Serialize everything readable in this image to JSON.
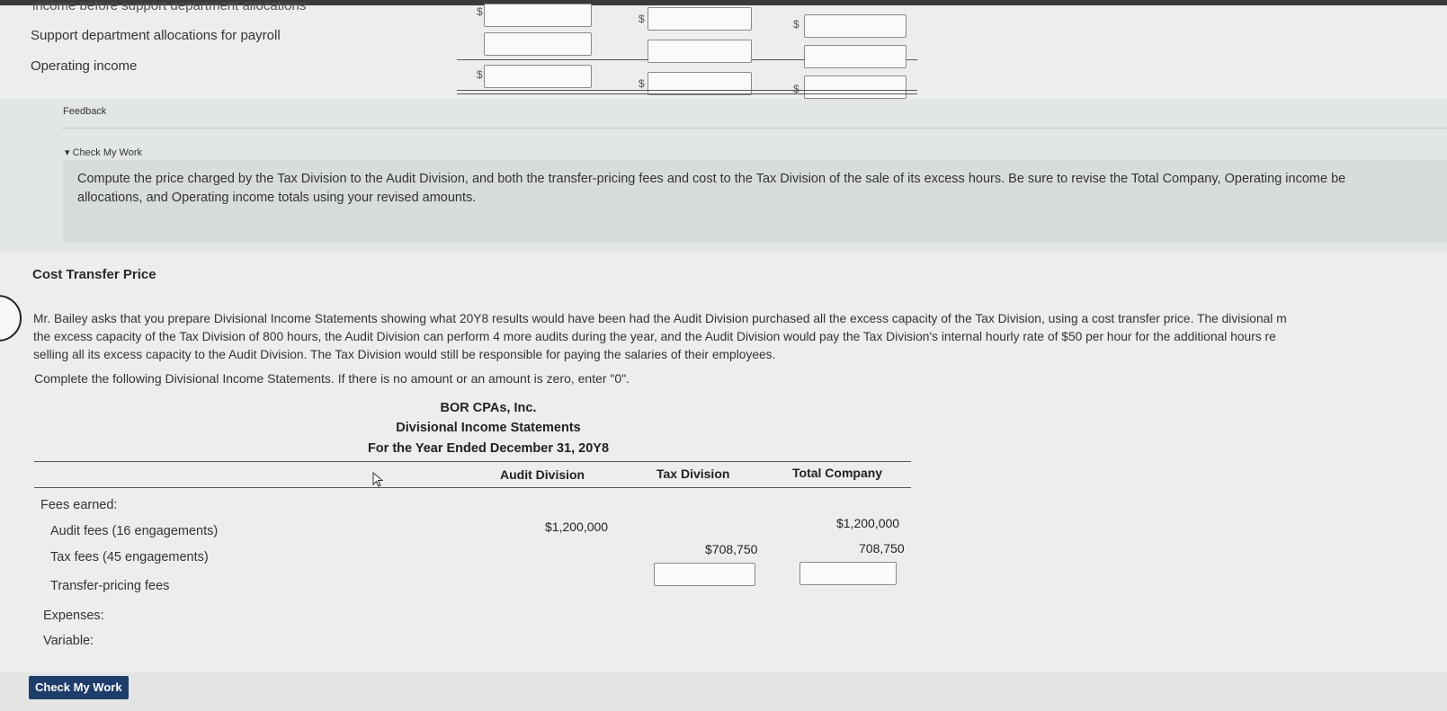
{
  "top_section": {
    "rows": [
      {
        "label": "income before support department allocations",
        "dollars": [
          "$",
          "$",
          "$"
        ]
      },
      {
        "label": "Support department allocations for payroll",
        "dollars": [
          "",
          "",
          ""
        ]
      },
      {
        "label": "Operating income",
        "dollars": [
          "$",
          "$",
          "$"
        ]
      }
    ]
  },
  "feedback": {
    "label": "Feedback",
    "toggle": "▾ Check My Work",
    "text_line1": "Compute the price charged by the Tax Division to the Audit Division, and both the transfer-pricing fees and cost to the Tax Division of the sale of its excess hours. Be sure to revise the Total Company, Operating income be",
    "text_line2": "allocations, and Operating income totals using your revised amounts."
  },
  "section": {
    "title": "Cost Transfer Price",
    "para_line1": "Mr. Bailey asks that you prepare Divisional Income Statements showing what 20Y8 results would have been had the Audit Division purchased all the excess capacity of the Tax Division, using a cost transfer price. The divisional m",
    "para_line2": "the excess capacity of the Tax Division of 800 hours, the Audit Division can perform 4 more audits during the year, and the Audit Division would pay the Tax Division's internal hourly rate of $50 per hour for the additional hours re",
    "para_line3": "selling all its excess capacity to the Audit Division. The Tax Division would still be responsible for paying the salaries of their employees.",
    "instruction": "Complete the following Divisional Income Statements. If there is no amount or an amount is zero, enter \"0\"."
  },
  "statement": {
    "company": "BOR CPAs, Inc.",
    "title": "Divisional Income Statements",
    "period": "For the Year Ended December 31, 20Y8",
    "columns": [
      "Audit Division",
      "Tax Division",
      "Total Company"
    ],
    "fees_earned": "Fees earned:",
    "audit_fees": {
      "label": "Audit fees (16 engagements)",
      "audit": "$1,200,000",
      "total": "$1,200,000"
    },
    "tax_fees": {
      "label": "Tax fees (45 engagements)",
      "tax": "$708,750",
      "total": "708,750"
    },
    "transfer_fees": {
      "label": "Transfer-pricing fees"
    },
    "expenses": "Expenses:",
    "variable": "Variable:"
  },
  "footer": {
    "check_button": "Check My Work"
  }
}
